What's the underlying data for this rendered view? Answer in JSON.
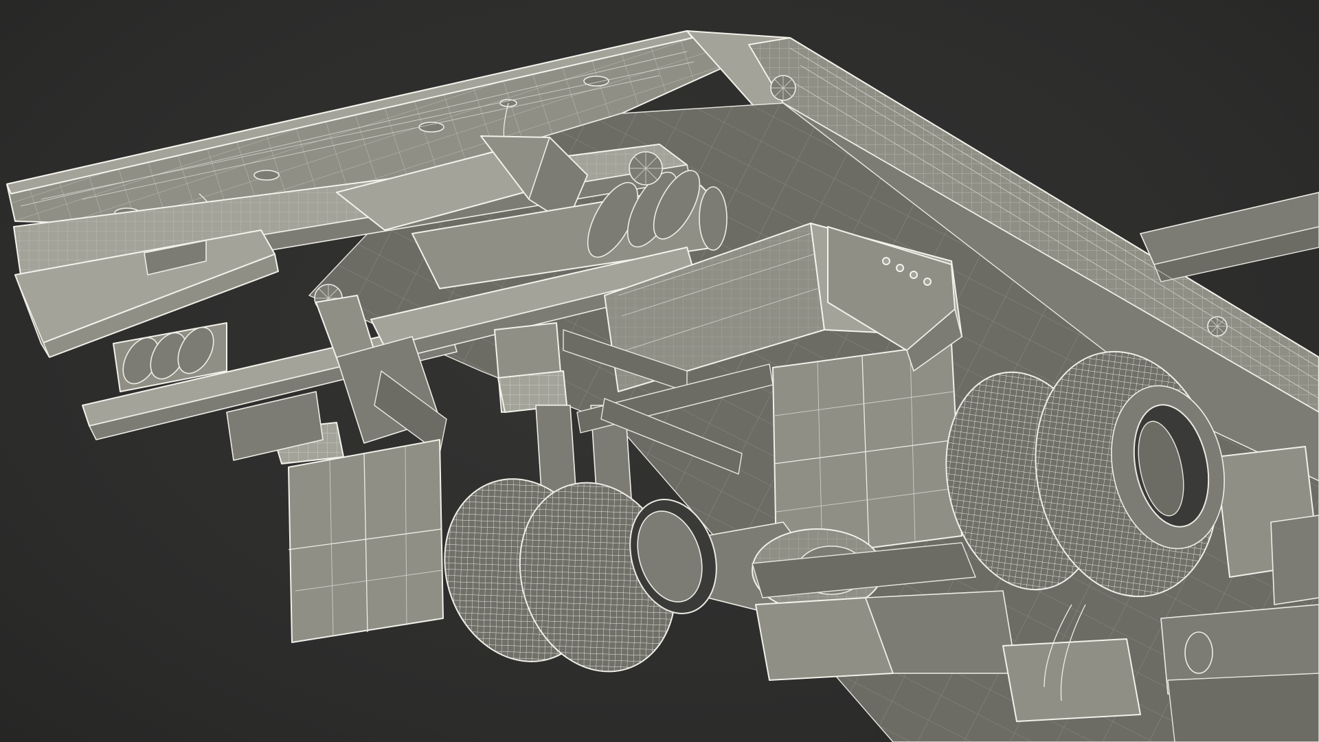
{
  "scene": {
    "subject": "wireframe-truck-chassis-underside",
    "colors": {
      "background": "#2d2d2c",
      "surface": "#8f8f86",
      "wire": "#f2f1ea"
    }
  }
}
